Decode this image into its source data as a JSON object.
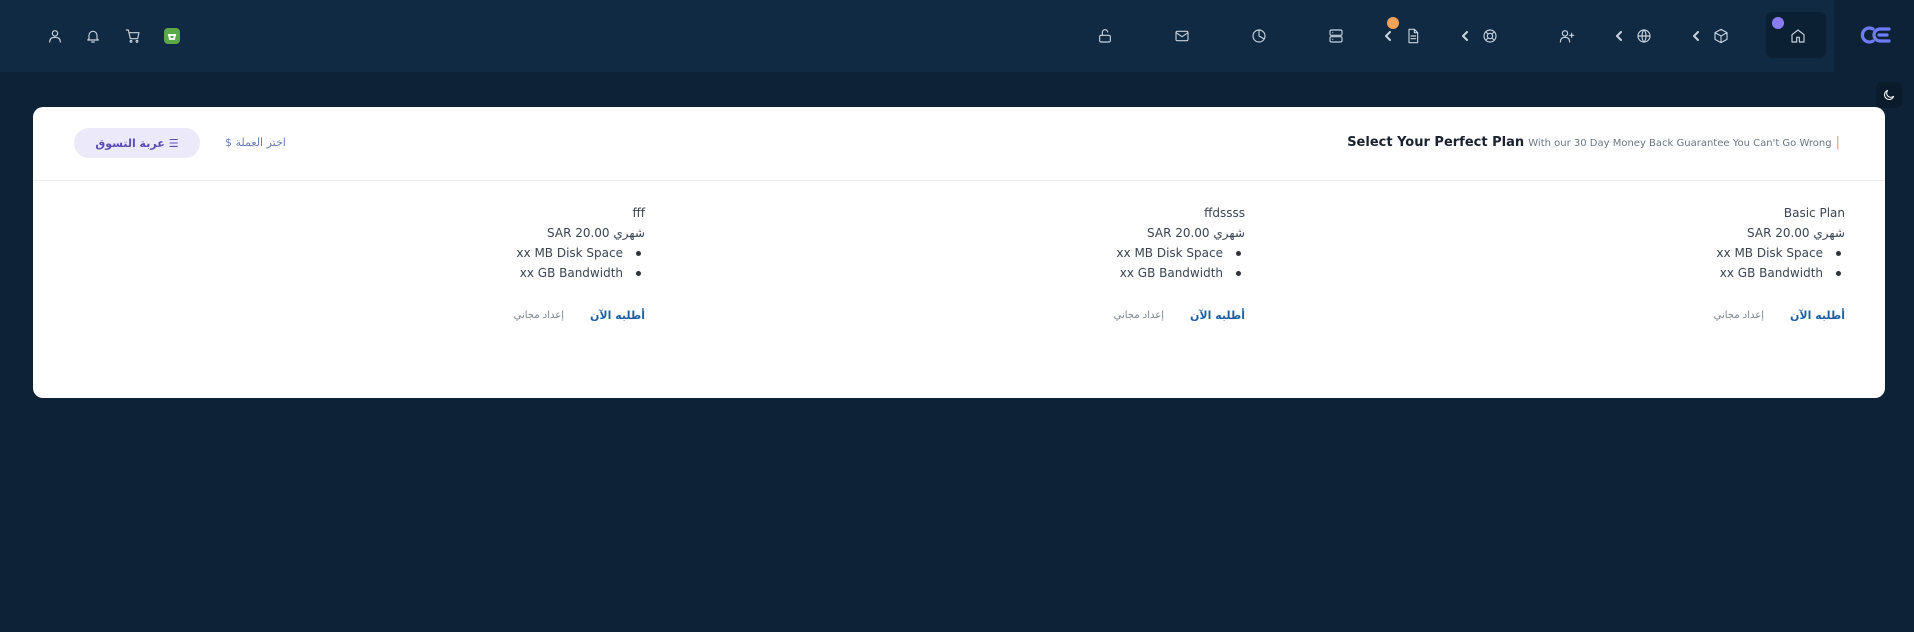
{
  "brand": {
    "logo_text": "CE",
    "logo_color": "#6366f1"
  },
  "header": {
    "title": "Select Your Perfect Plan",
    "subtitle": "With our 30 Day Money Back Guarantee You Can't Go Wrong",
    "currency_label": "$ اختر العملة",
    "cart_label": "عربة التسوق"
  },
  "plans": [
    {
      "name": "Basic Plan",
      "price": "SAR 20.00 شهري",
      "features": [
        "xx MB Disk Space",
        "xx GB Bandwidth"
      ],
      "order_label": "أطلبه الآن",
      "setup_label": "إعداد مجاني"
    },
    {
      "name": "ffdssss",
      "price": "SAR 20.00 شهري",
      "features": [
        "xx MB Disk Space",
        "xx GB Bandwidth"
      ],
      "order_label": "أطلبه الآن",
      "setup_label": "إعداد مجاني"
    },
    {
      "name": "fff",
      "price": "SAR 20.00 شهري",
      "features": [
        "xx MB Disk Space",
        "xx GB Bandwidth"
      ],
      "order_label": "أطلبه الآن",
      "setup_label": "إعداد مجاني"
    }
  ],
  "icons": {
    "home": "home-icon",
    "box": "box-icon",
    "globe": "globe-icon",
    "user_plus": "user-plus-icon",
    "support": "lifebuoy-icon",
    "document": "document-icon",
    "server": "server-icon",
    "chart": "pie-chart-icon",
    "mail": "mail-icon",
    "lock": "unlock-icon",
    "cart": "cart-icon",
    "bell": "bell-icon",
    "user": "user-icon",
    "moon": "moon-icon"
  },
  "colors": {
    "topbar": "#0f2a42",
    "background": "#0d2236",
    "badge_purple": "#8b7cf6",
    "badge_orange": "#f4a259",
    "order_link": "#1f5fa0",
    "cart_button": "#ece9fb"
  }
}
